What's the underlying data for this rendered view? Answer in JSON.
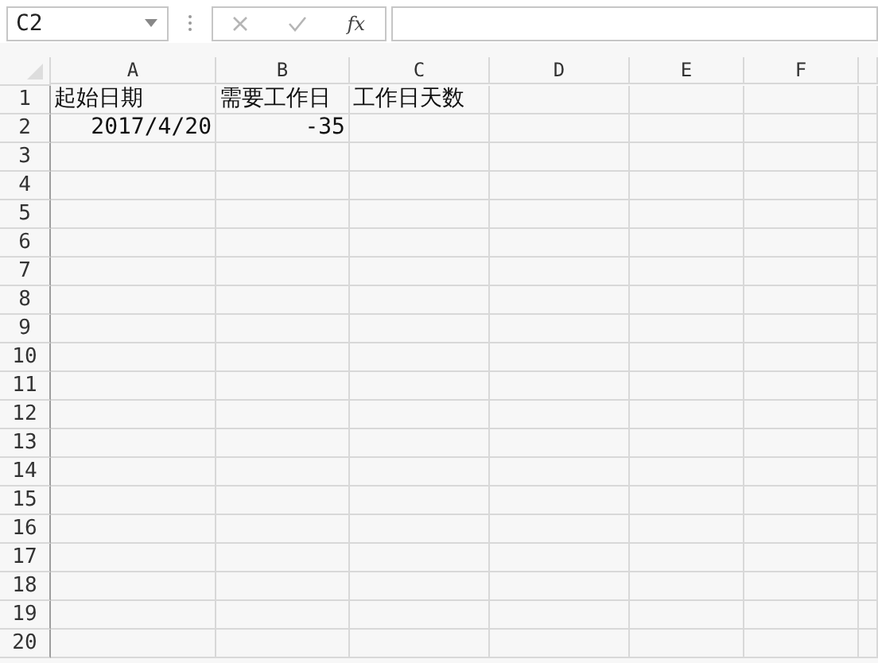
{
  "name_box": {
    "value": "C2"
  },
  "formula_bar": {
    "function_button": "fx"
  },
  "columns": [
    "A",
    "B",
    "C",
    "D",
    "E",
    "F"
  ],
  "rows": [
    {
      "header": "1",
      "cells": [
        {
          "text": "起始日期",
          "kind": "text"
        },
        {
          "text": "需要工作日",
          "kind": "text"
        },
        {
          "text": "工作日天数",
          "kind": "text"
        }
      ]
    },
    {
      "header": "2",
      "cells": [
        {
          "text": "2017/4/20",
          "kind": "number"
        },
        {
          "text": "-35",
          "kind": "number"
        }
      ]
    },
    {
      "header": "3",
      "cells": []
    },
    {
      "header": "4",
      "cells": []
    },
    {
      "header": "5",
      "cells": []
    },
    {
      "header": "6",
      "cells": []
    },
    {
      "header": "7",
      "cells": []
    },
    {
      "header": "8",
      "cells": []
    },
    {
      "header": "9",
      "cells": []
    },
    {
      "header": "10",
      "cells": []
    },
    {
      "header": "11",
      "cells": []
    },
    {
      "header": "12",
      "cells": []
    },
    {
      "header": "13",
      "cells": []
    },
    {
      "header": "14",
      "cells": []
    },
    {
      "header": "15",
      "cells": []
    },
    {
      "header": "16",
      "cells": []
    },
    {
      "header": "17",
      "cells": []
    },
    {
      "header": "18",
      "cells": []
    },
    {
      "header": "19",
      "cells": []
    },
    {
      "header": "20",
      "cells": []
    }
  ]
}
